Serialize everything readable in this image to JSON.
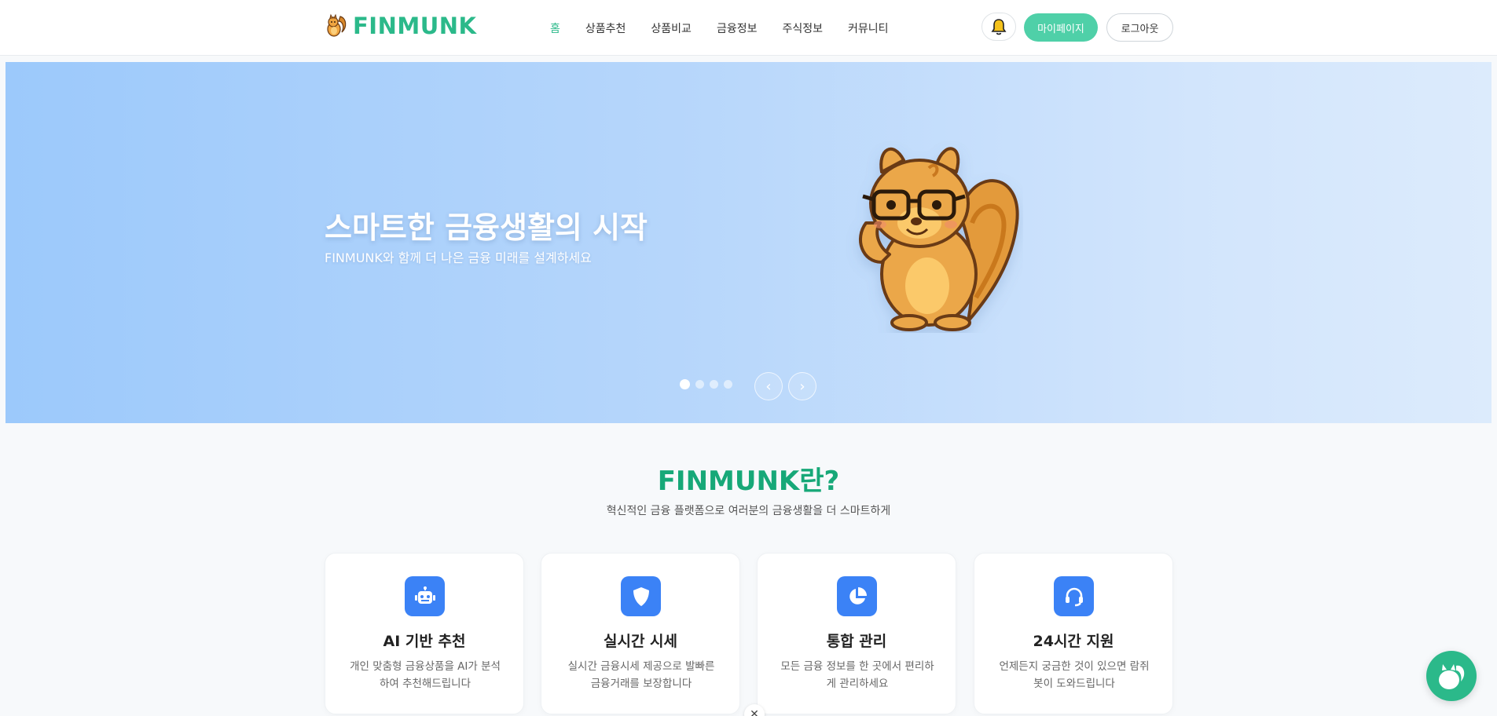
{
  "header": {
    "logo_text": "FINMUNK",
    "nav": [
      {
        "label": "홈",
        "active": true
      },
      {
        "label": "상품추천"
      },
      {
        "label": "상품비교"
      },
      {
        "label": "금융정보"
      },
      {
        "label": "주식정보"
      },
      {
        "label": "커뮤니티"
      }
    ],
    "mypage_label": "마이페이지",
    "logout_label": "로그아웃"
  },
  "hero": {
    "title": "스마트한 금융생활의 시작",
    "subtitle": "FINMUNK와 함께 더 나은 금융 미래를 설계하세요",
    "prev_label": "‹",
    "next_label": "›"
  },
  "about": {
    "title": "FINMUNK란?",
    "subtitle": "혁신적인 금융 플랫폼으로 여러분의 금융생활을 더 스마트하게",
    "features": [
      {
        "icon": "robot-icon",
        "title": "AI 기반 추천",
        "desc": "개인 맞춤형 금융상품을 AI가 분석하여 추천해드립니다"
      },
      {
        "icon": "shield-icon",
        "title": "실시간 시세",
        "desc": "실시간 금융시세 제공으로 발빠른 금융거래를 보장합니다"
      },
      {
        "icon": "pie-chart-icon",
        "title": "통합 관리",
        "desc": "모든 금융 정보를 한 곳에서 편리하게 관리하세요"
      },
      {
        "icon": "headset-icon",
        "title": "24시간 지원",
        "desc": "언제든지 궁금한 것이 있으면 람쥐봇이 도와드립니다"
      }
    ]
  },
  "colors": {
    "brand": "#2bb98a",
    "accent_blue": "#3b82f6"
  },
  "misc": {
    "close_glyph": "✕"
  }
}
